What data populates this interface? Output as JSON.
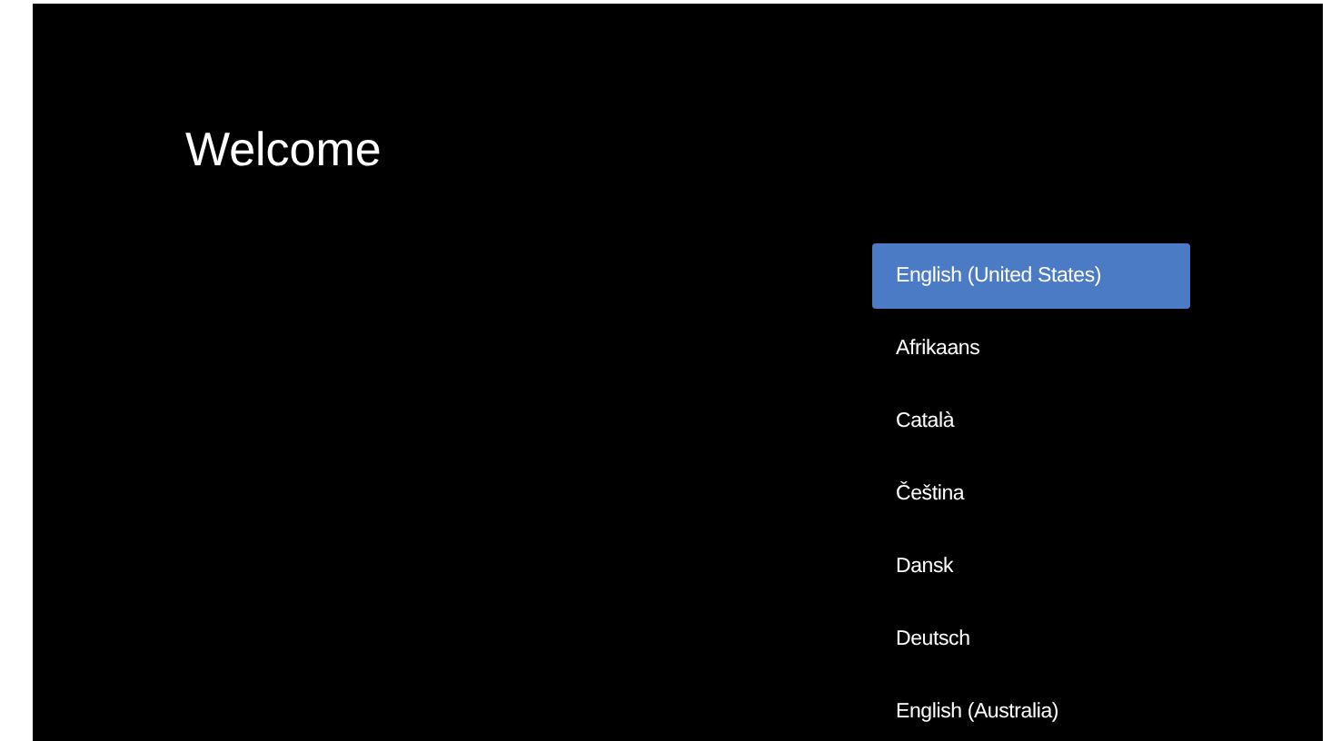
{
  "title": "Welcome",
  "languages": [
    {
      "label": "English (United States)",
      "selected": true
    },
    {
      "label": "Afrikaans",
      "selected": false
    },
    {
      "label": "Català",
      "selected": false
    },
    {
      "label": "Čeština",
      "selected": false
    },
    {
      "label": "Dansk",
      "selected": false
    },
    {
      "label": "Deutsch",
      "selected": false
    },
    {
      "label": "English (Australia)",
      "selected": false
    }
  ]
}
